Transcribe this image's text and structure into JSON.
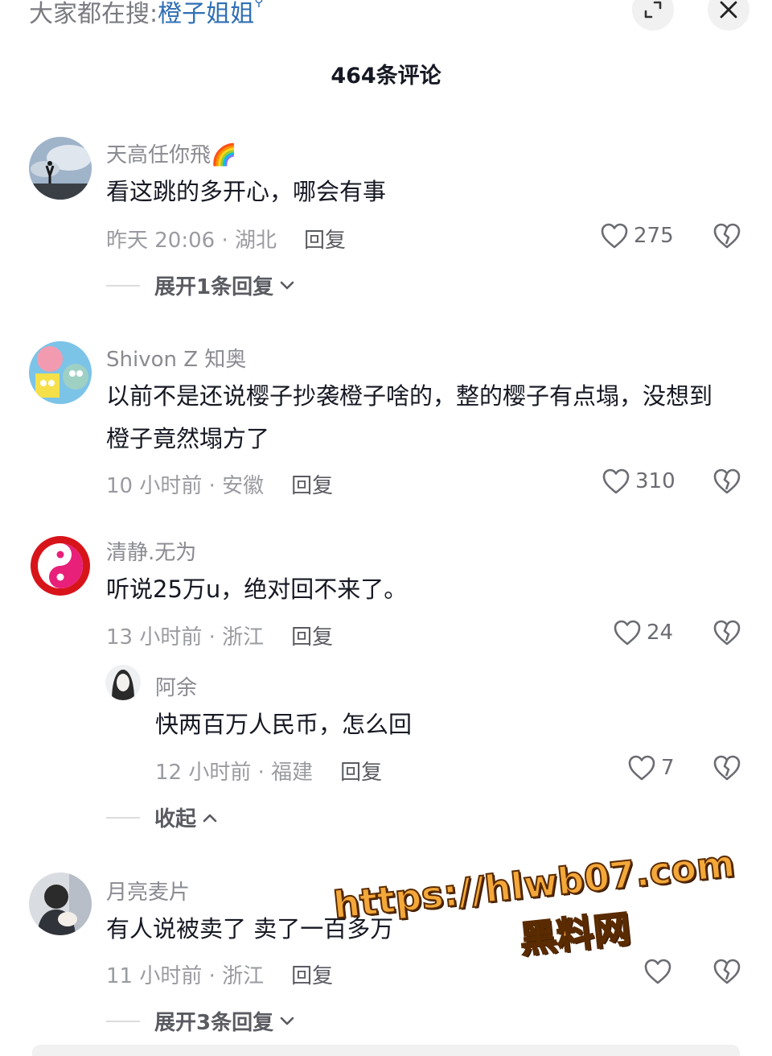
{
  "header": {
    "search_prefix": "大家都在搜:",
    "search_keyword": "橙子姐姐",
    "comment_count": "464条评论"
  },
  "comments": [
    {
      "username": "天高任你飛🌈",
      "text": "看这跳的多开心，哪会有事",
      "meta": "昨天 20:06 · 湖北",
      "reply_label": "回复",
      "likes": "275",
      "expand_label": "展开1条回复"
    },
    {
      "username": "Shivon Z 知奥",
      "text": "以前不是还说樱子抄袭橙子啥的，整的樱子有点塌，没想到橙子竟然塌方了",
      "meta": "10 小时前 · 安徽",
      "reply_label": "回复",
      "likes": "310"
    },
    {
      "username": "清静.无为",
      "text": "听说25万u，绝对回不来了。",
      "meta": "13 小时前 · 浙江",
      "reply_label": "回复",
      "likes": "24",
      "reply": {
        "username": "阿余",
        "text": "快两百万人民币，怎么回",
        "meta": "12 小时前 · 福建",
        "reply_label": "回复",
        "likes": "7"
      },
      "collapse_label": "收起"
    },
    {
      "username": "月亮麦片",
      "text": "有人说被卖了 卖了一百多万",
      "meta": "11 小时前 · 浙江",
      "reply_label": "回复",
      "likes": "",
      "expand_label": "展开3条回复"
    }
  ],
  "watermark": {
    "url": "https://hlwb07.com",
    "name": "黑料网"
  },
  "icons": {
    "expand": "expand-icon",
    "close": "close-icon",
    "like": "heart-icon",
    "dislike": "broken-heart-icon",
    "chevron_down": "chevron-down-icon",
    "chevron_up": "chevron-up-icon"
  },
  "colors": {
    "keyword": "#2f6fb5",
    "watermark_fill": "#f4a83a"
  }
}
